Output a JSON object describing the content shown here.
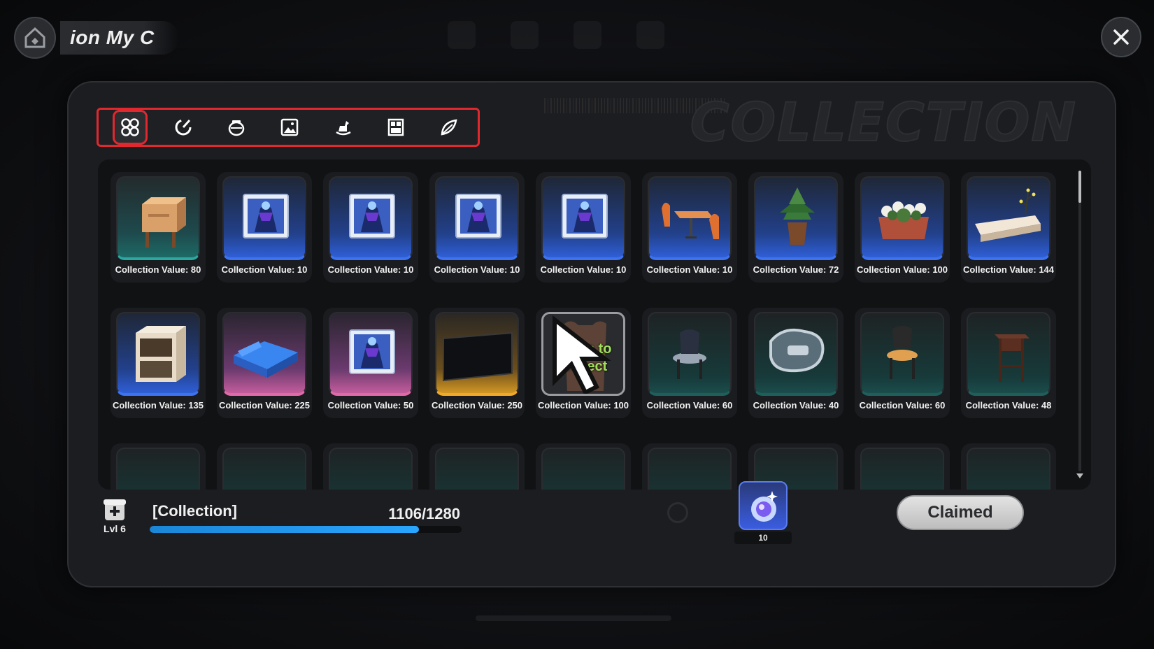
{
  "header": {
    "title": "ion  My C"
  },
  "panel": {
    "watermark": "COLLECTION"
  },
  "categories": [
    {
      "icon": "all-grid-icon",
      "active": true
    },
    {
      "icon": "swirl-icon",
      "active": false
    },
    {
      "icon": "pot-icon",
      "active": false
    },
    {
      "icon": "picture-icon",
      "active": false
    },
    {
      "icon": "rocking-horse-icon",
      "active": false
    },
    {
      "icon": "window-panel-icon",
      "active": false
    },
    {
      "icon": "leaf-icon",
      "active": false
    }
  ],
  "items": [
    {
      "label": "Collection Value: 80",
      "rarity": "teal",
      "art": "nightstand"
    },
    {
      "label": "Collection Value: 10",
      "rarity": "blue",
      "art": "poster"
    },
    {
      "label": "Collection Value: 10",
      "rarity": "blue",
      "art": "poster"
    },
    {
      "label": "Collection Value: 10",
      "rarity": "blue",
      "art": "poster"
    },
    {
      "label": "Collection Value: 10",
      "rarity": "blue",
      "art": "poster"
    },
    {
      "label": "Collection Value: 10",
      "rarity": "blue",
      "art": "dining-set"
    },
    {
      "label": "Collection Value: 72",
      "rarity": "blue",
      "art": "potted-plant"
    },
    {
      "label": "Collection Value: 100",
      "rarity": "blue",
      "art": "flower-planter"
    },
    {
      "label": "Collection Value: 144",
      "rarity": "blue",
      "art": "long-planter"
    },
    {
      "label": "Collection Value: 135",
      "rarity": "blue",
      "art": "cabinet"
    },
    {
      "label": "Collection Value: 225",
      "rarity": "pink",
      "art": "sofa-bed"
    },
    {
      "label": "Collection Value: 50",
      "rarity": "pink",
      "art": "poster"
    },
    {
      "label": "Collection Value: 250",
      "rarity": "gold",
      "art": "tv-screen"
    },
    {
      "label": "Collection Value: 100",
      "rarity": "grey",
      "art": "press-collect",
      "press_text_1": "Press to",
      "press_text_2": "Collect"
    },
    {
      "label": "Collection Value: 60",
      "rarity": "darkteal",
      "art": "chair"
    },
    {
      "label": "Collection Value: 40",
      "rarity": "darkteal",
      "art": "tray"
    },
    {
      "label": "Collection Value: 60",
      "rarity": "darkteal",
      "art": "stool-chair"
    },
    {
      "label": "Collection Value: 48",
      "rarity": "darkteal",
      "art": "side-table"
    }
  ],
  "footer": {
    "level": "Lvl 6",
    "collection_name": "[Collection]",
    "progress_text": "1106/1280",
    "progress_fraction": 0.864,
    "reward_qty": "10",
    "claim_button": "Claimed"
  },
  "colors": {
    "highlight_red": "#e0282e",
    "progress_blue": "#2aa6ff",
    "press_green": "#9fe05a"
  }
}
